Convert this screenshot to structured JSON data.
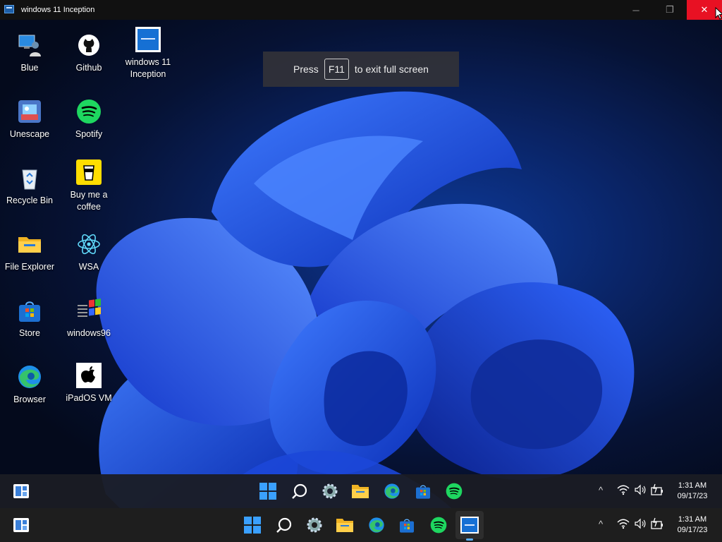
{
  "window": {
    "title": "windows 11 Inception",
    "minimize": "─",
    "restore": "❐",
    "close": "✕"
  },
  "fullscreen_hint": {
    "before": "Press",
    "key": "F11",
    "after": "to exit full screen"
  },
  "desktop_icons": [
    {
      "label": "Blue",
      "icon": "person-pc-icon"
    },
    {
      "label": "Github",
      "icon": "github-icon"
    },
    {
      "label": "windows 11 Inception",
      "icon": "windows-app-icon"
    },
    {
      "label": "Unescape",
      "icon": "unescape-icon"
    },
    {
      "label": "Spotify",
      "icon": "spotify-icon"
    },
    {
      "label": "Recycle Bin",
      "icon": "recycle-bin-icon"
    },
    {
      "label": "Buy me a coffee",
      "icon": "coffee-icon"
    },
    {
      "label": "File Explorer",
      "icon": "folder-icon"
    },
    {
      "label": "WSA",
      "icon": "react-icon"
    },
    {
      "label": "Store",
      "icon": "store-icon"
    },
    {
      "label": "windows96",
      "icon": "windows96-icon"
    },
    {
      "label": "Browser",
      "icon": "edge-icon"
    },
    {
      "label": "iPadOS VM",
      "icon": "apple-icon"
    }
  ],
  "taskbar_inner": {
    "apps": [
      "start-icon",
      "search-icon",
      "settings-icon",
      "folder-icon",
      "edge-icon",
      "store-icon",
      "spotify-icon"
    ],
    "tray": {
      "chevron": "^",
      "time": "1:31 AM",
      "date": "09/17/23"
    }
  },
  "taskbar_outer": {
    "apps": [
      "start-icon",
      "search-icon",
      "settings-icon",
      "folder-icon",
      "edge-icon",
      "store-icon",
      "spotify-icon",
      "windows-app-icon"
    ],
    "tray": {
      "chevron": "^",
      "time": "1:31 AM",
      "date": "09/17/23"
    }
  },
  "colors": {
    "close_red": "#e81123",
    "wallpaper_blue": "#1f4fe0",
    "spotify_green": "#1ed760"
  }
}
